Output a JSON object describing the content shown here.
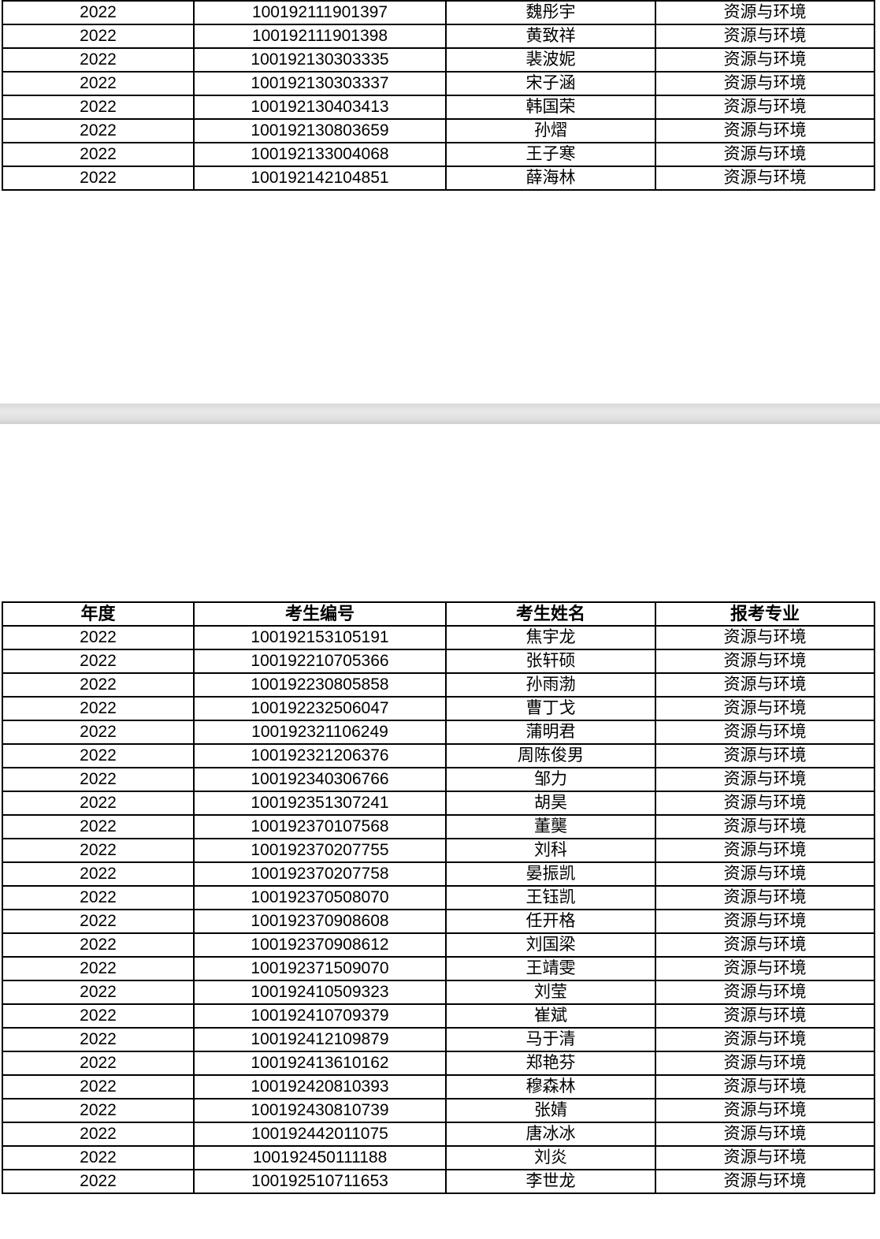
{
  "top_table": {
    "rows": [
      {
        "year": "2022",
        "id": "100192111901397",
        "name": "魏彤宇",
        "major": "资源与环境"
      },
      {
        "year": "2022",
        "id": "100192111901398",
        "name": "黄致祥",
        "major": "资源与环境"
      },
      {
        "year": "2022",
        "id": "100192130303335",
        "name": "裴波妮",
        "major": "资源与环境"
      },
      {
        "year": "2022",
        "id": "100192130303337",
        "name": "宋子涵",
        "major": "资源与环境"
      },
      {
        "year": "2022",
        "id": "100192130403413",
        "name": "韩国荣",
        "major": "资源与环境"
      },
      {
        "year": "2022",
        "id": "100192130803659",
        "name": "孙熠",
        "major": "资源与环境"
      },
      {
        "year": "2022",
        "id": "100192133004068",
        "name": "王子寒",
        "major": "资源与环境"
      },
      {
        "year": "2022",
        "id": "100192142104851",
        "name": "薛海林",
        "major": "资源与环境"
      }
    ]
  },
  "bottom_table": {
    "headers": {
      "year": "年度",
      "id": "考生编号",
      "name": "考生姓名",
      "major": "报考专业"
    },
    "rows": [
      {
        "year": "2022",
        "id": "100192153105191",
        "name": "焦宇龙",
        "major": "资源与环境"
      },
      {
        "year": "2022",
        "id": "100192210705366",
        "name": "张轩硕",
        "major": "资源与环境"
      },
      {
        "year": "2022",
        "id": "100192230805858",
        "name": "孙雨渤",
        "major": "资源与环境"
      },
      {
        "year": "2022",
        "id": "100192232506047",
        "name": "曹丁戈",
        "major": "资源与环境"
      },
      {
        "year": "2022",
        "id": "100192321106249",
        "name": "蒲明君",
        "major": "资源与环境"
      },
      {
        "year": "2022",
        "id": "100192321206376",
        "name": "周陈俊男",
        "major": "资源与环境"
      },
      {
        "year": "2022",
        "id": "100192340306766",
        "name": "邹力",
        "major": "资源与环境"
      },
      {
        "year": "2022",
        "id": "100192351307241",
        "name": "胡昊",
        "major": "资源与环境"
      },
      {
        "year": "2022",
        "id": "100192370107568",
        "name": "董龑",
        "major": "资源与环境"
      },
      {
        "year": "2022",
        "id": "100192370207755",
        "name": "刘科",
        "major": "资源与环境"
      },
      {
        "year": "2022",
        "id": "100192370207758",
        "name": "晏振凯",
        "major": "资源与环境"
      },
      {
        "year": "2022",
        "id": "100192370508070",
        "name": "王钰凯",
        "major": "资源与环境"
      },
      {
        "year": "2022",
        "id": "100192370908608",
        "name": "任开格",
        "major": "资源与环境"
      },
      {
        "year": "2022",
        "id": "100192370908612",
        "name": "刘国梁",
        "major": "资源与环境"
      },
      {
        "year": "2022",
        "id": "100192371509070",
        "name": "王靖雯",
        "major": "资源与环境"
      },
      {
        "year": "2022",
        "id": "100192410509323",
        "name": "刘莹",
        "major": "资源与环境"
      },
      {
        "year": "2022",
        "id": "100192410709379",
        "name": "崔斌",
        "major": "资源与环境"
      },
      {
        "year": "2022",
        "id": "100192412109879",
        "name": "马于清",
        "major": "资源与环境"
      },
      {
        "year": "2022",
        "id": "100192413610162",
        "name": "郑艳芬",
        "major": "资源与环境"
      },
      {
        "year": "2022",
        "id": "100192420810393",
        "name": "穆森林",
        "major": "资源与环境"
      },
      {
        "year": "2022",
        "id": "100192430810739",
        "name": "张婧",
        "major": "资源与环境"
      },
      {
        "year": "2022",
        "id": "100192442011075",
        "name": "唐冰冰",
        "major": "资源与环境"
      },
      {
        "year": "2022",
        "id": "100192450111188",
        "name": "刘炎",
        "major": "资源与环境"
      },
      {
        "year": "2022",
        "id": "100192510711653",
        "name": "李世龙",
        "major": "资源与环境"
      }
    ]
  }
}
